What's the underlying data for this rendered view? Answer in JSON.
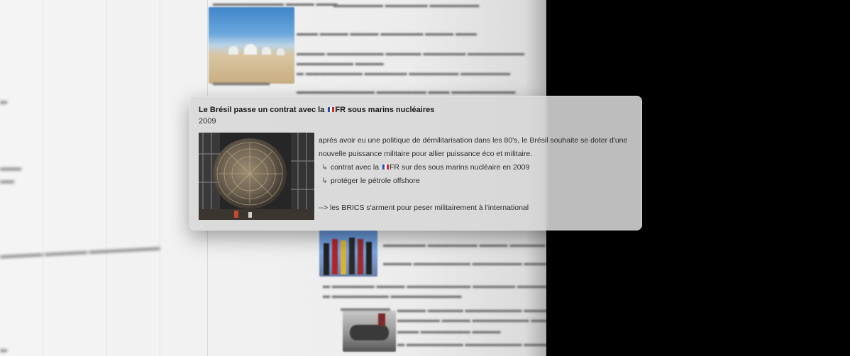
{
  "card": {
    "title_before_flag": "Le Brésil passe un contrat avec la ",
    "title_after_flag": "FR sous marins nucléaires",
    "year": "2009",
    "paragraph_line1": "après avoir eu une politique de démilitarisation dans les 80's, le Brésil souhaite se doter d'une",
    "paragraph_line2": "nouvelle puissance militaire pour allier puissance éco et militaire.",
    "bullet1_before_flag": "contrat avec la ",
    "bullet1_after_flag": "FR sur des sous marins nucléaire en 2009",
    "bullet2": "protéger le pétrole offshore",
    "conclusion": "--> les BRICS s'arment pour peser militairement à l'international",
    "bullet_symbol": "↳",
    "flag_icon": "french-flag-icon",
    "photo_icon": "submarine-hull-photo"
  },
  "colors": {
    "card_bg": "#d7d7d7",
    "flag_blue": "#2350b5",
    "flag_red": "#d7262b"
  }
}
